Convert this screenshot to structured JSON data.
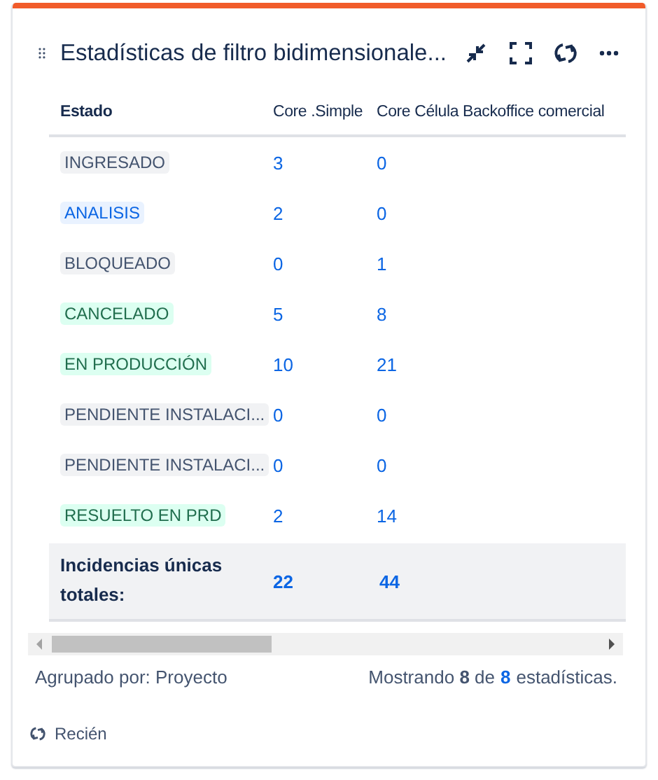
{
  "gadget": {
    "title": "Estadísticas de filtro bidimensionale..."
  },
  "table": {
    "columns": [
      "Estado",
      "Core .Simple",
      "Core Célula Backoffice comercial"
    ],
    "rows": [
      {
        "status": "INGRESADO",
        "kind": "default",
        "values": [
          "3",
          "0"
        ]
      },
      {
        "status": "ANALISIS",
        "kind": "inprogress",
        "values": [
          "2",
          "0"
        ]
      },
      {
        "status": "BLOQUEADO",
        "kind": "default",
        "values": [
          "0",
          "1"
        ]
      },
      {
        "status": "CANCELADO",
        "kind": "success",
        "values": [
          "5",
          "8"
        ]
      },
      {
        "status": "EN PRODUCCIÓN",
        "kind": "success",
        "values": [
          "10",
          "21"
        ]
      },
      {
        "status": "PENDIENTE INSTALACI...",
        "kind": "default",
        "values": [
          "0",
          "0"
        ]
      },
      {
        "status": "PENDIENTE INSTALACI...",
        "kind": "default",
        "values": [
          "0",
          "0"
        ]
      },
      {
        "status": "RESUELTO EN PRD",
        "kind": "success",
        "values": [
          "2",
          "14"
        ]
      }
    ],
    "totals": {
      "label": "Incidencias únicas totales:",
      "values": [
        "22",
        "44"
      ]
    }
  },
  "footer": {
    "grouped_by": "Agrupado por: Proyecto",
    "summary": {
      "prefix": "Mostrando",
      "shown": "8",
      "middle": "de",
      "total": "8",
      "suffix": "estadísticas."
    }
  },
  "updated": "Recién"
}
